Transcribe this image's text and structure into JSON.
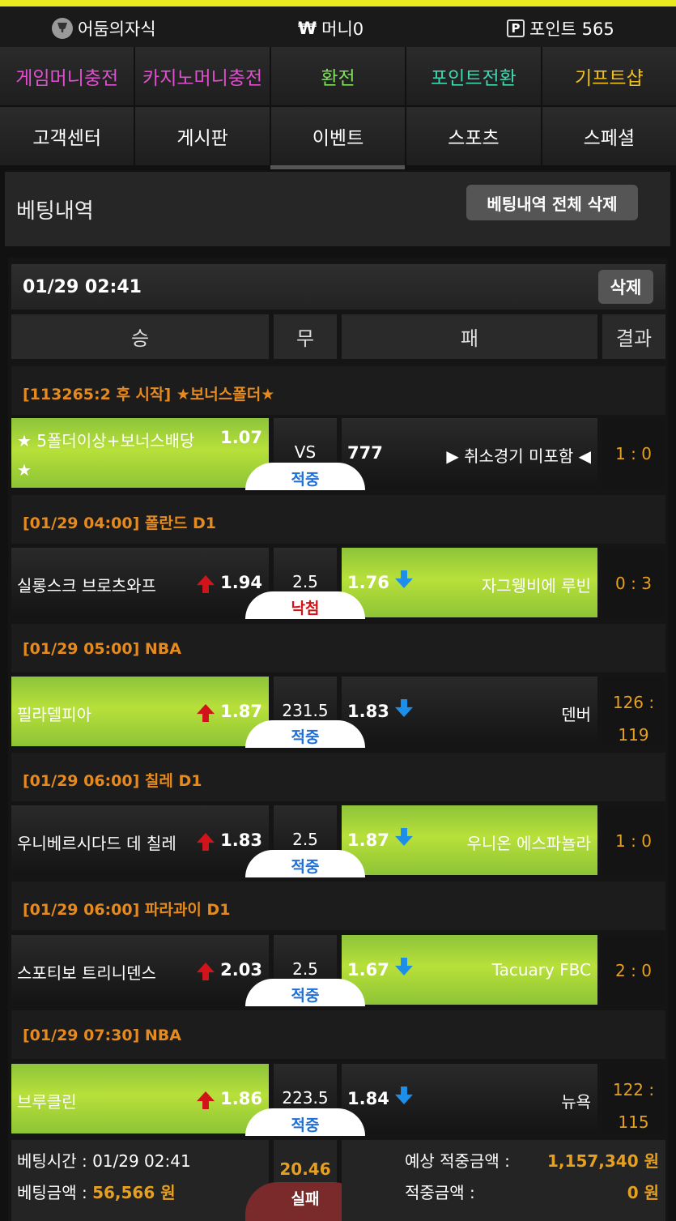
{
  "header": {
    "user_name": "어둠의자식",
    "money_symbol": "₩",
    "money_label": "머니0",
    "point_icon_letter": "P",
    "point_label": "포인트 565"
  },
  "menu_row1": [
    {
      "label": "게임머니충전",
      "color": "#e04fd0"
    },
    {
      "label": "카지노머니충전",
      "color": "#e04fd0"
    },
    {
      "label": "환전",
      "color": "#7ee05a"
    },
    {
      "label": "포인트전환",
      "color": "#3fd6b0"
    },
    {
      "label": "기프트샵",
      "color": "#f0c020"
    }
  ],
  "menu_row2": [
    {
      "label": "고객센터"
    },
    {
      "label": "게시판"
    },
    {
      "label": "이벤트"
    },
    {
      "label": "스포츠"
    },
    {
      "label": "스페셜"
    }
  ],
  "panel": {
    "title": "베팅내역",
    "delete_all_label": "베팅내역 전체 삭제"
  },
  "bet": {
    "datetime": "01/29 02:41",
    "delete_label": "삭제",
    "columns": {
      "win": "승",
      "draw": "무",
      "lose": "패",
      "result": "결과"
    },
    "games": [
      {
        "league": "[113265:2 후 시작] ★보너스폴더★",
        "home": "★ 5폴더이상+보너스배당",
        "home_line2": "★",
        "home_odd": "1.07",
        "mid": "VS",
        "away_odd": "777",
        "away": "▶ 취소경기 미포함 ◀",
        "result": "1 : 0",
        "result_line2": "",
        "status": "적중",
        "pick": "home"
      },
      {
        "league": "[01/29 04:00] 폴란드 D1",
        "home": "실롱스크 브로츠와프",
        "home_line2": "",
        "home_odd": "1.94",
        "mid": "2.5",
        "away_odd": "1.76",
        "away": "자그웽비에 루빈",
        "result": "0 : 3",
        "result_line2": "",
        "status": "낙첨",
        "pick": "away"
      },
      {
        "league": "[01/29 05:00] NBA",
        "home": "필라델피아",
        "home_line2": "",
        "home_odd": "1.87",
        "mid": "231.5",
        "away_odd": "1.83",
        "away": "덴버",
        "result": "126 :",
        "result_line2": "119",
        "status": "적중",
        "pick": "home"
      },
      {
        "league": "[01/29 06:00] 칠레 D1",
        "home": "우니베르시다드 데 칠레",
        "home_line2": "",
        "home_odd": "1.83",
        "mid": "2.5",
        "away_odd": "1.87",
        "away": "우니온 에스파뇰라",
        "result": "1 : 0",
        "result_line2": "",
        "status": "적중",
        "pick": "away"
      },
      {
        "league": "[01/29 06:00] 파라과이 D1",
        "home": "스포티보 트리니덴스",
        "home_line2": "",
        "home_odd": "2.03",
        "mid": "2.5",
        "away_odd": "1.67",
        "away": "Tacuary FBC",
        "result": "2 : 0",
        "result_line2": "",
        "status": "적중",
        "pick": "away"
      },
      {
        "league": "[01/29 07:30] NBA",
        "home": "브루클린",
        "home_line2": "",
        "home_odd": "1.86",
        "mid": "223.5",
        "away_odd": "1.84",
        "away": "뉴욕",
        "result": "122 :",
        "result_line2": "115",
        "status": "적중",
        "pick": "home"
      }
    ],
    "footer": {
      "bet_time_label": "베팅시간 : ",
      "bet_time": "01/29 02:41",
      "bet_amount_label": "베팅금액 : ",
      "bet_amount": "56,566 원",
      "total_odds": "20.46",
      "status": "실패",
      "expected_label": "예상 적중금액 :",
      "expected_amount": "1,157,340 원",
      "won_label": "적중금액 :",
      "won_amount": "0 원"
    }
  }
}
